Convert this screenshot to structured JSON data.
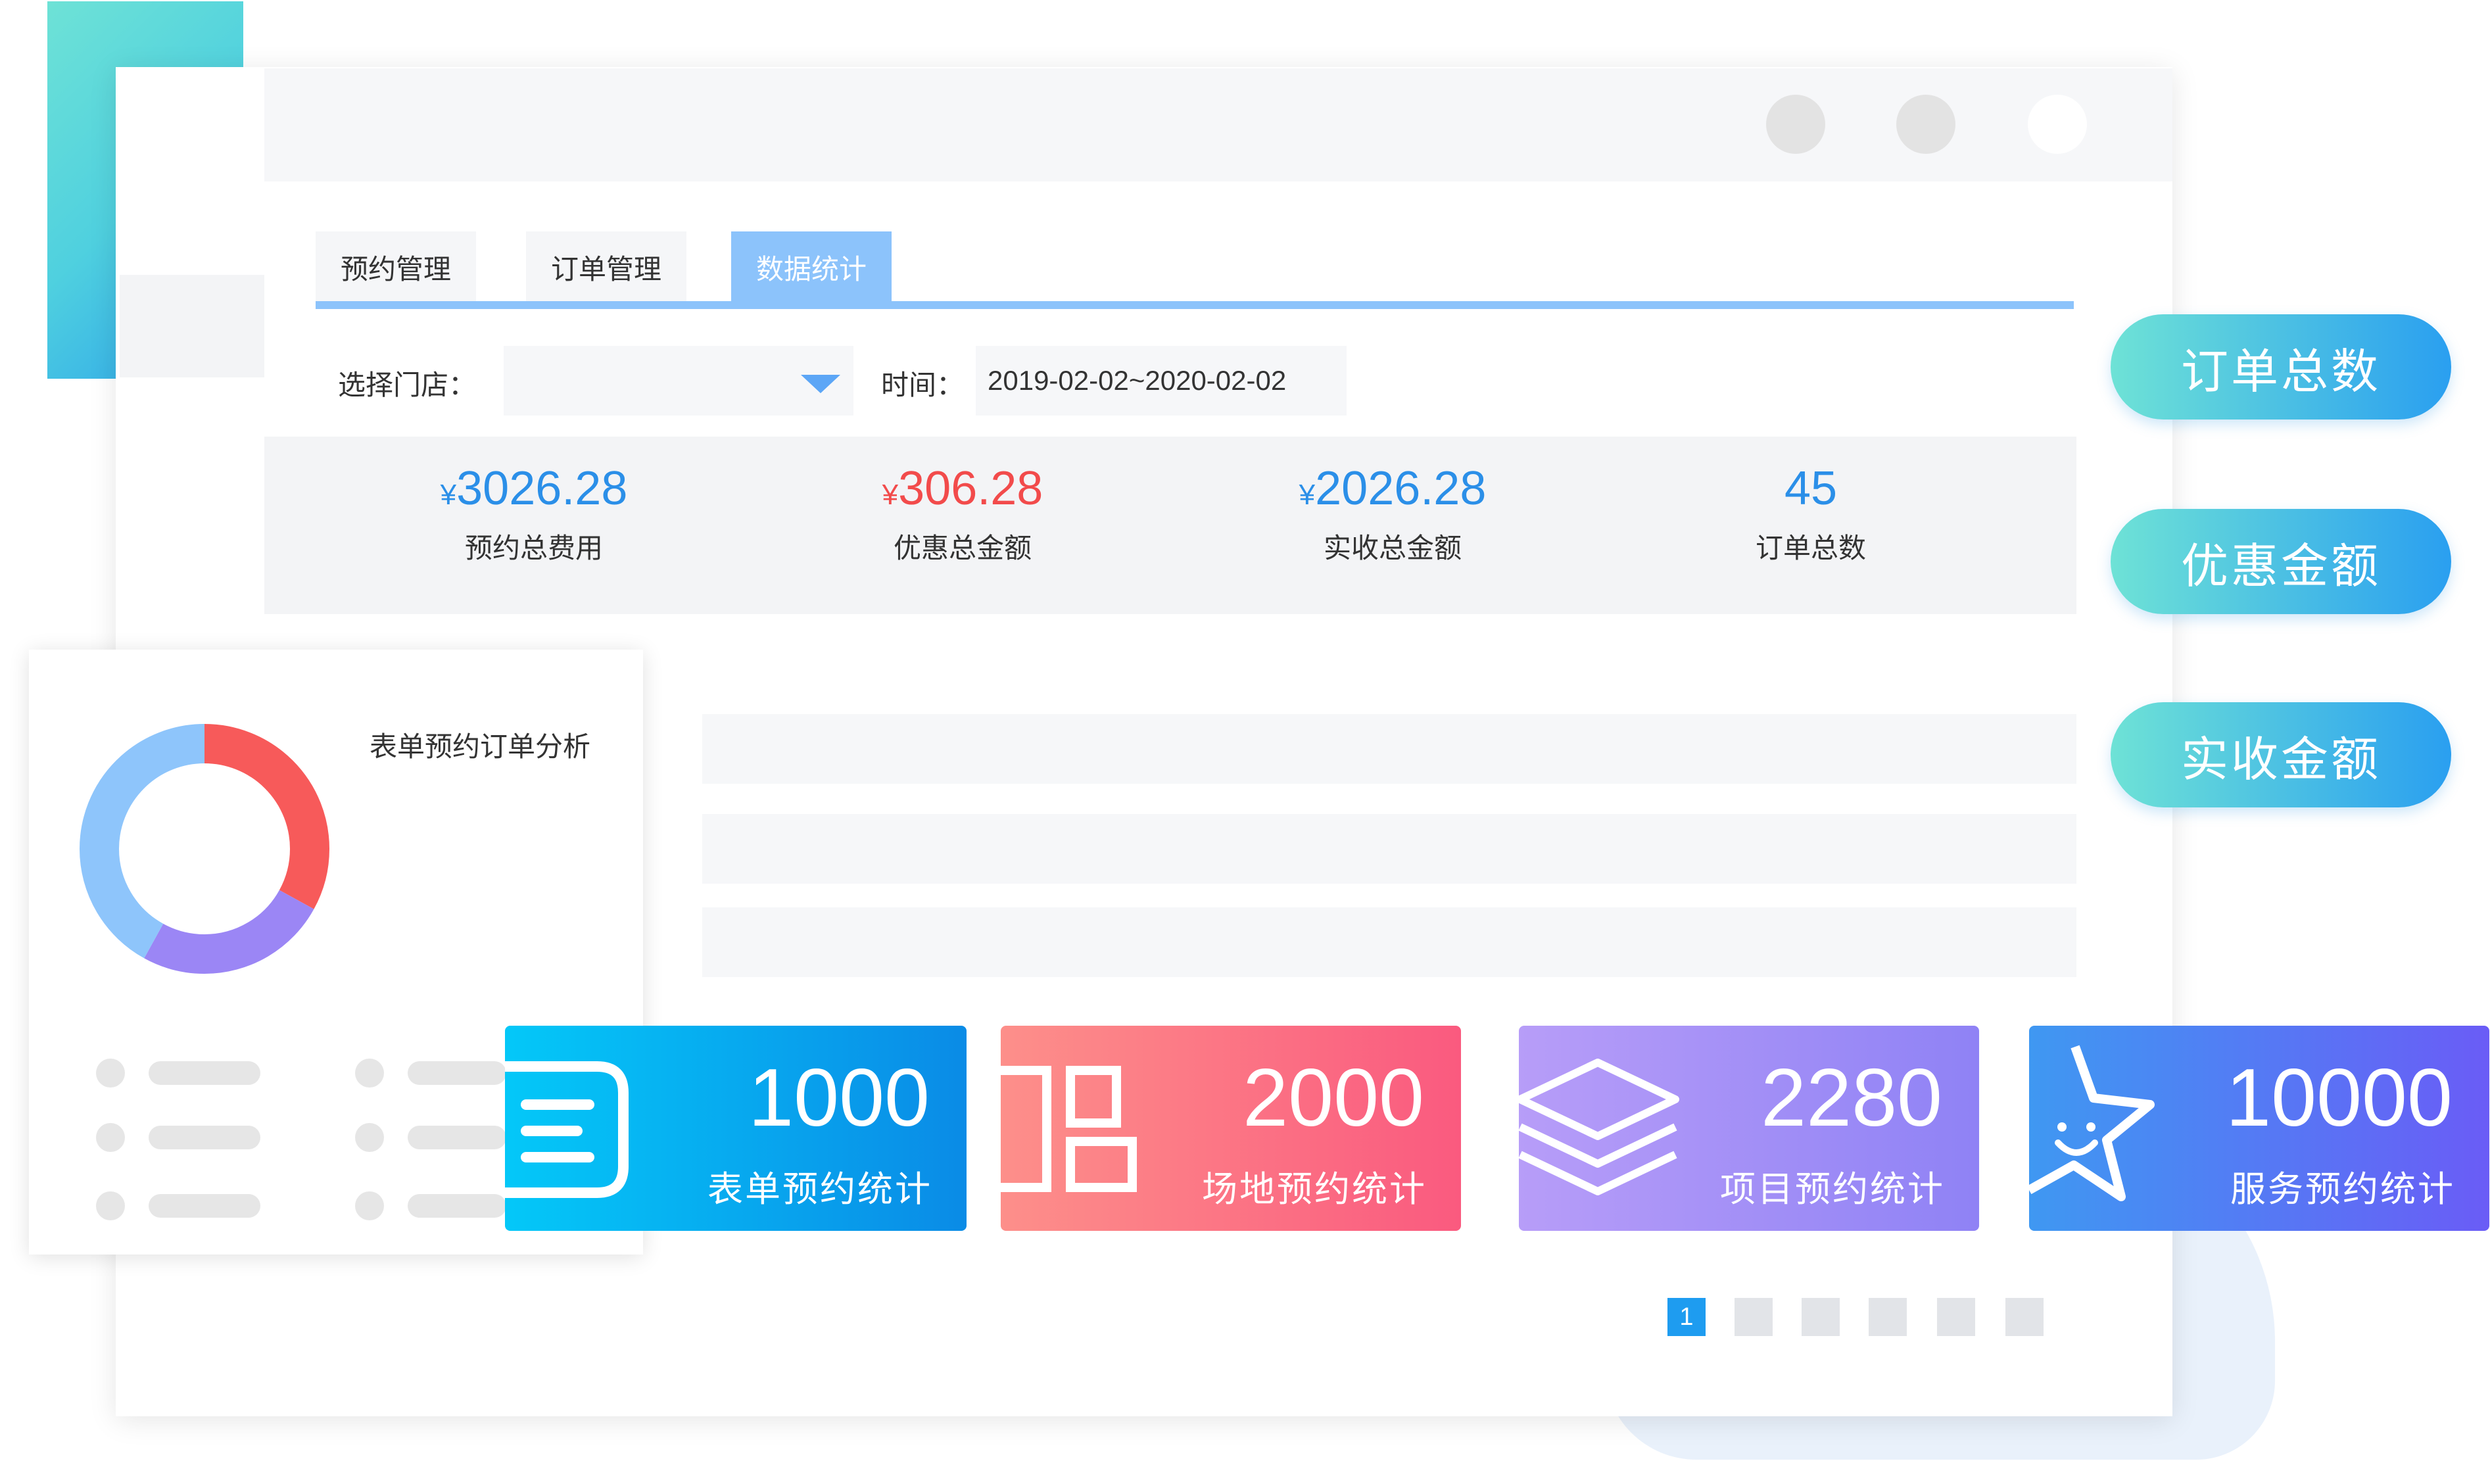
{
  "colors": {
    "accent_blue": "#1e9cf0",
    "tab_active": "#8cc3fb",
    "value_blue": "#2b8fe8",
    "value_red": "#f24b4b",
    "teal_gradient_start": "#6ee2d6",
    "teal_gradient_end": "#2a9ff0"
  },
  "tabs": [
    {
      "label": "预约管理",
      "active": false
    },
    {
      "label": "订单管理",
      "active": false
    },
    {
      "label": "数据统计",
      "active": true
    }
  ],
  "filters": {
    "store_label": "选择门店：",
    "store_value": "",
    "time_label": "时间：",
    "time_value": "2019-02-02~2020-02-02"
  },
  "stats": [
    {
      "currency": "¥",
      "value": "3026.28",
      "label": "预约总费用",
      "color": "#2b8fe8"
    },
    {
      "currency": "¥",
      "value": "306.28",
      "label": "优惠总金额",
      "color": "#f24b4b"
    },
    {
      "currency": "¥",
      "value": "2026.28",
      "label": "实收总金额",
      "color": "#2b8fe8"
    },
    {
      "currency": "",
      "value": "45",
      "label": "订单总数",
      "color": "#2b8fe8"
    }
  ],
  "chart_card": {
    "title": "表单预约订单分析"
  },
  "chart_data": {
    "type": "pie",
    "title": "表单预约订单分析",
    "donut": true,
    "slices": [
      {
        "value": 33,
        "color": "#f75a5a"
      },
      {
        "value": 25,
        "color": "#9b86f5"
      },
      {
        "value": 42,
        "color": "#8ec5fb"
      }
    ]
  },
  "pills": [
    {
      "label": "订单总数"
    },
    {
      "label": "优惠金额"
    },
    {
      "label": "实收金额"
    }
  ],
  "cards": [
    {
      "number": "1000",
      "label": "表单预约统计",
      "icon": "form-icon",
      "gradient": [
        "#04c8f8",
        "#0a8be6"
      ]
    },
    {
      "number": "2000",
      "label": "场地预约统计",
      "icon": "layout-icon",
      "gradient": [
        "#fd8f8a",
        "#fa5a7f"
      ]
    },
    {
      "number": "2280",
      "label": "项目预约统计",
      "icon": "layers-icon",
      "gradient": [
        "#b79df8",
        "#8f82f5"
      ]
    },
    {
      "number": "10000",
      "label": "服务预约统计",
      "icon": "star-icon",
      "gradient": [
        "#3f98f2",
        "#6a5cf6"
      ]
    }
  ],
  "pagination": {
    "current": "1"
  }
}
